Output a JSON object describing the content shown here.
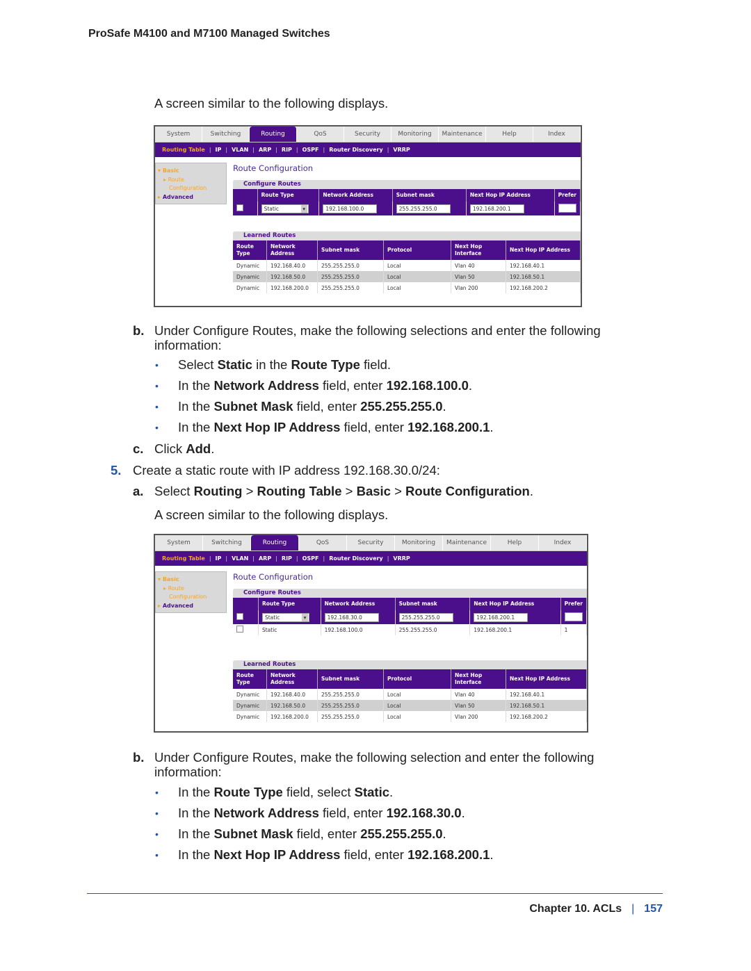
{
  "header": {
    "title": "ProSafe M4100 and M7100 Managed Switches"
  },
  "colors": {
    "accent": "#2155a8",
    "ui_purple": "#4b0f8c",
    "ui_orange": "#f5a623"
  },
  "text": {
    "screen1": "A screen similar to the following displays.",
    "b1_label": "b.",
    "b1_line1": "Under Configure Routes, make the following selections and enter the following",
    "b1_line2": "information:",
    "b1_bullets": [
      [
        "Select ",
        [
          "Static"
        ],
        " in the ",
        [
          "Route Type"
        ],
        " field."
      ],
      [
        "In the ",
        [
          "Network Address"
        ],
        " field, enter ",
        [
          "192.168.100.0"
        ],
        "."
      ],
      [
        "In the ",
        [
          "Subnet Mask"
        ],
        " field, enter ",
        [
          "255.255.255.0"
        ],
        "."
      ],
      [
        "In the ",
        [
          "Next Hop IP Address"
        ],
        " field, enter ",
        [
          "192.168.200.1"
        ],
        "."
      ]
    ],
    "c_label": "c.",
    "c_text": [
      "Click ",
      [
        "Add"
      ],
      "."
    ],
    "step5_label": "5.",
    "step5_text": "Create a static route with IP address 192.168.30.0/24:",
    "a_label": "a.",
    "a_text": [
      "Select ",
      [
        "Routing"
      ],
      " > ",
      [
        "Routing Table"
      ],
      " > ",
      [
        "Basic"
      ],
      " > ",
      [
        "Route Configuration"
      ],
      "."
    ],
    "screen2": "A screen similar to the following displays.",
    "b2_label": "b.",
    "b2_line1": "Under Configure Routes, make the following selection and enter the following",
    "b2_line2": "information:",
    "b2_bullets": [
      [
        "In the ",
        [
          "Route Type"
        ],
        " field, select ",
        [
          "Static"
        ],
        "."
      ],
      [
        "In the ",
        [
          "Network Address"
        ],
        " field, enter ",
        [
          "192.168.30.0"
        ],
        "."
      ],
      [
        "In the ",
        [
          "Subnet Mask"
        ],
        " field, enter ",
        [
          "255.255.255.0"
        ],
        "."
      ],
      [
        "In the ",
        [
          "Next Hop IP Address"
        ],
        " field, enter ",
        [
          "192.168.200.1"
        ],
        "."
      ]
    ],
    "bullet_char": "•"
  },
  "screenshots": [
    {
      "tabs": [
        "System",
        "Switching",
        "Routing",
        "QoS",
        "Security",
        "Monitoring",
        "Maintenance",
        "Help",
        "Index"
      ],
      "active_tab": "Routing",
      "subnav": [
        "Routing Table",
        "IP",
        "VLAN",
        "ARP",
        "RIP",
        "OSPF",
        "Router Discovery",
        "VRRP"
      ],
      "active_subnav": "Routing Table",
      "sidebar": {
        "basic": "Basic",
        "route": "Route",
        "configuration": "Configuration",
        "advanced": "Advanced"
      },
      "title": "Route Configuration",
      "configure_header": "Configure Routes",
      "configure_columns": [
        "",
        "Route Type",
        "Network Address",
        "Subnet mask",
        "Next Hop IP Address",
        "Prefer"
      ],
      "input_row": {
        "route_type": "Static",
        "network": "192.168.100.0",
        "subnet": "255.255.255.0",
        "next_hop": "192.168.200.1",
        "preference": ""
      },
      "static_rows": [],
      "learned_header": "Learned Routes",
      "learned_columns": [
        "Route Type",
        "Network Address",
        "Subnet mask",
        "Protocol",
        "Next Hop Interface",
        "Next Hop IP Address"
      ],
      "learned_rows": [
        [
          "Dynamic",
          "192.168.40.0",
          "255.255.255.0",
          "Local",
          "Vlan 40",
          "192.168.40.1"
        ],
        [
          "Dynamic",
          "192.168.50.0",
          "255.255.255.0",
          "Local",
          "Vlan 50",
          "192.168.50.1"
        ],
        [
          "Dynamic",
          "192.168.200.0",
          "255.255.255.0",
          "Local",
          "Vlan 200",
          "192.168.200.2"
        ]
      ]
    },
    {
      "tabs": [
        "System",
        "Switching",
        "Routing",
        "QoS",
        "Security",
        "Monitoring",
        "Maintenance",
        "Help",
        "Index"
      ],
      "active_tab": "Routing",
      "subnav": [
        "Routing Table",
        "IP",
        "VLAN",
        "ARP",
        "RIP",
        "OSPF",
        "Router Discovery",
        "VRRP"
      ],
      "active_subnav": "Routing Table",
      "sidebar": {
        "basic": "Basic",
        "route": "Route",
        "configuration": "Configuration",
        "advanced": "Advanced"
      },
      "title": "Route Configuration",
      "configure_header": "Configure Routes",
      "configure_columns": [
        "",
        "Route Type",
        "Network Address",
        "Subnet mask",
        "Next Hop IP Address",
        "Prefer"
      ],
      "input_row": {
        "route_type": "Static",
        "network": "192.168.30.0",
        "subnet": "255.255.255.0",
        "next_hop": "192.168.200.1",
        "preference": ""
      },
      "static_rows": [
        [
          "Static",
          "192.168.100.0",
          "255.255.255.0",
          "192.168.200.1",
          "1"
        ]
      ],
      "learned_header": "Learned Routes",
      "learned_columns": [
        "Route Type",
        "Network Address",
        "Subnet mask",
        "Protocol",
        "Next Hop Interface",
        "Next Hop IP Address"
      ],
      "learned_rows": [
        [
          "Dynamic",
          "192.168.40.0",
          "255.255.255.0",
          "Local",
          "Vlan 40",
          "192.168.40.1"
        ],
        [
          "Dynamic",
          "192.168.50.0",
          "255.255.255.0",
          "Local",
          "Vlan 50",
          "192.168.50.1"
        ],
        [
          "Dynamic",
          "192.168.200.0",
          "255.255.255.0",
          "Local",
          "Vlan 200",
          "192.168.200.2"
        ]
      ]
    }
  ],
  "footer": {
    "chapter": "Chapter 10.  ACLs",
    "separator": "|",
    "page": "157"
  }
}
